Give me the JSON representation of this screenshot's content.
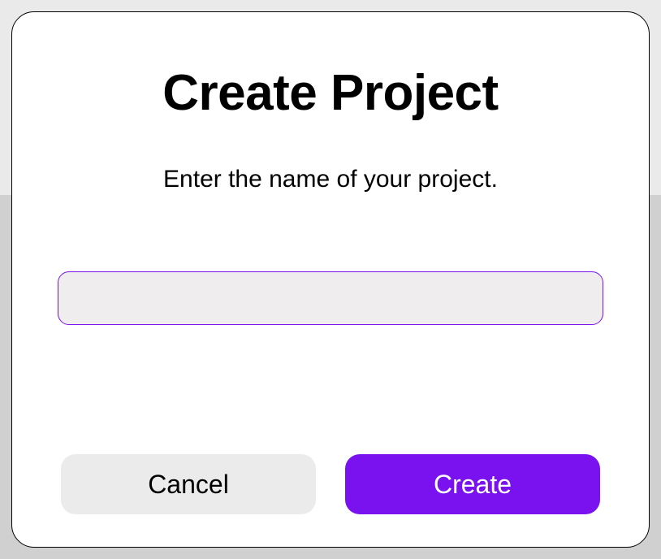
{
  "dialog": {
    "title": "Create Project",
    "subtitle": "Enter the name of your project.",
    "input": {
      "value": "",
      "placeholder": ""
    },
    "buttons": {
      "cancel": "Cancel",
      "create": "Create"
    }
  },
  "colors": {
    "accent": "#7a12f0",
    "input_bg": "#efedee",
    "cancel_bg": "#ecebeb"
  }
}
